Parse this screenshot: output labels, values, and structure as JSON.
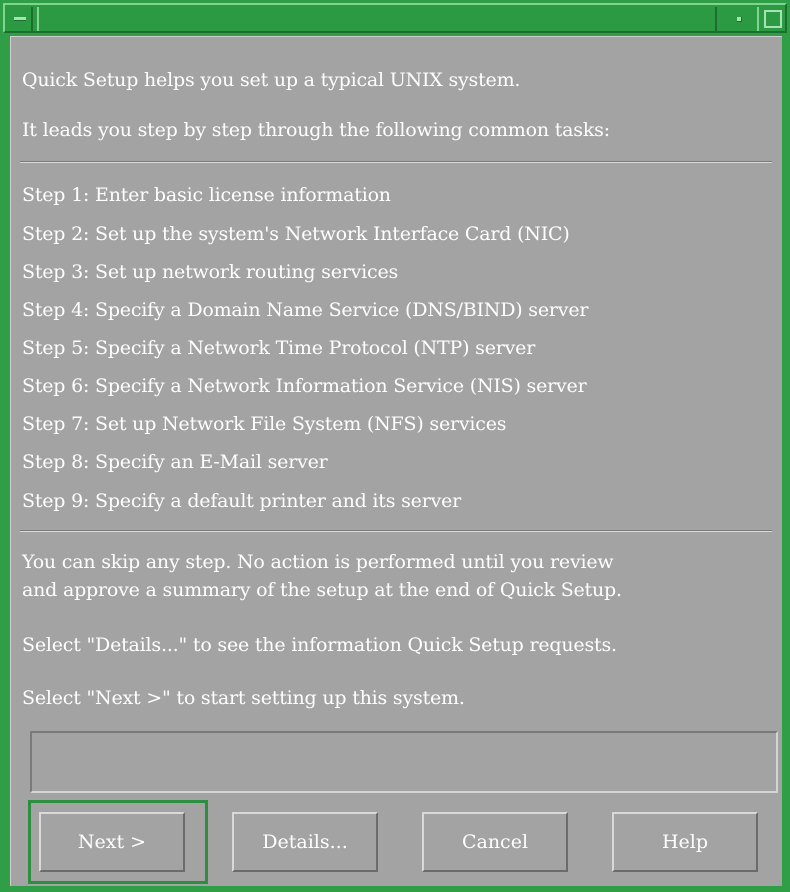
{
  "window": {
    "title": "",
    "accent": "#2f9e46",
    "background": "#a3a3a3",
    "text_color": "#ffffff"
  },
  "titlebar": {
    "menu_icon": "window-menu-icon",
    "minimize_icon": "minimize-icon",
    "maximize_icon": "maximize-icon"
  },
  "intro": {
    "line1": "Quick Setup helps you set up a typical UNIX system.",
    "line2": "It leads you step by step through the following common tasks:"
  },
  "steps": [
    "Step 1: Enter basic license information",
    "Step 2: Set up the system's Network Interface Card (NIC)",
    "Step 3: Set up network routing services",
    "Step 4: Specify a Domain Name Service (DNS/BIND) server",
    "Step 5: Specify a Network Time Protocol (NTP) server",
    "Step 6: Specify a Network Information Service (NIS) server",
    "Step 7: Set up Network File System (NFS) services",
    "Step 8: Specify an E-Mail server",
    "Step 9: Specify a default printer and its server"
  ],
  "notes": {
    "skip_line1": "You can skip any step. No action is performed until you review",
    "skip_line2": "and approve a summary of the setup at the end of Quick Setup.",
    "details_hint": "Select \"Details...\" to see the information Quick Setup requests.",
    "next_hint": "Select \"Next >\" to start setting up this system."
  },
  "status": {
    "text": ""
  },
  "buttons": {
    "next": "Next >",
    "details": "Details...",
    "cancel": "Cancel",
    "help": "Help"
  }
}
